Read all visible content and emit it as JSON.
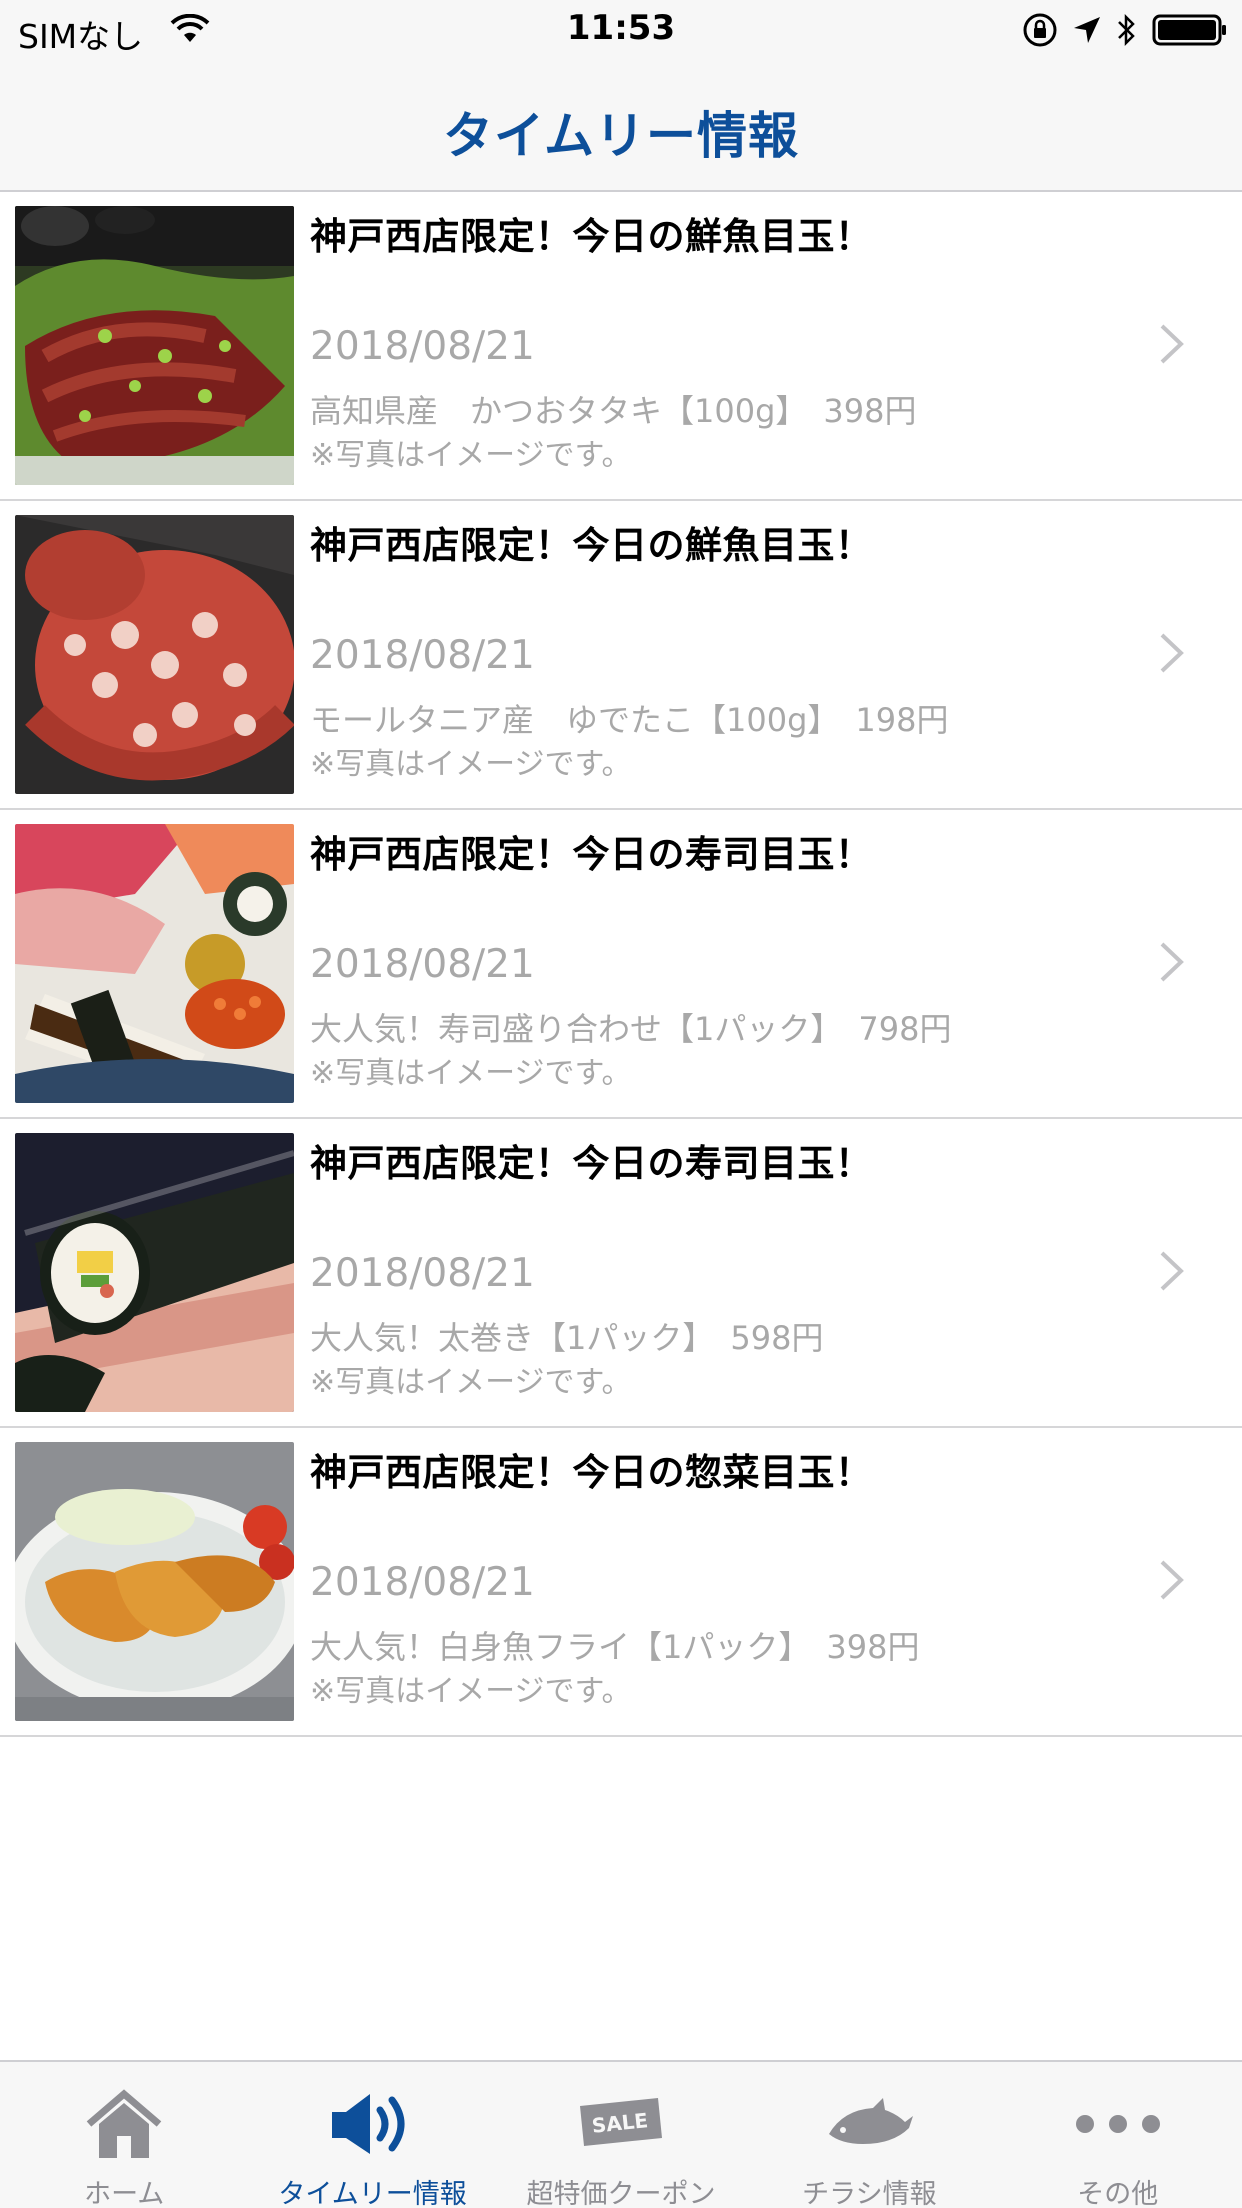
{
  "status_bar": {
    "carrier": "SIMなし",
    "time": "11:53"
  },
  "nav": {
    "title": "タイムリー情報"
  },
  "items": [
    {
      "title": "神戸西店限定！今日の鮮魚目玉！",
      "date": "2018/08/21",
      "description": "高知県産　かつおタタキ【100g】　398円",
      "note": "※写真はイメージです。",
      "image_icon": "katsuo-tataki-photo"
    },
    {
      "title": "神戸西店限定！今日の鮮魚目玉！",
      "date": "2018/08/21",
      "description": "モールタニア産　ゆでたこ【100g】　198円",
      "note": "※写真はイメージです。",
      "image_icon": "boiled-octopus-photo"
    },
    {
      "title": "神戸西店限定！今日の寿司目玉！",
      "date": "2018/08/21",
      "description": "大人気！寿司盛り合わせ【1パック】　798円",
      "note": "※写真はイメージです。",
      "image_icon": "sushi-platter-photo"
    },
    {
      "title": "神戸西店限定！今日の寿司目玉！",
      "date": "2018/08/21",
      "description": "大人気！太巻き【1パック】　598円",
      "note": "※写真はイメージです。",
      "image_icon": "futomaki-photo"
    },
    {
      "title": "神戸西店限定！今日の惣菜目玉！",
      "date": "2018/08/21",
      "description": "大人気！白身魚フライ【1パック】　398円",
      "note": "※写真はイメージです。",
      "image_icon": "fish-fry-photo"
    }
  ],
  "tabs": [
    {
      "label": "ホーム",
      "icon": "home-icon",
      "active": false
    },
    {
      "label": "タイムリー情報",
      "icon": "speaker-icon",
      "active": true
    },
    {
      "label": "超特価クーポン",
      "icon": "sale-tag-icon",
      "active": false
    },
    {
      "label": "チラシ情報",
      "icon": "fish-icon",
      "active": false
    },
    {
      "label": "その他",
      "icon": "more-icon",
      "active": false
    }
  ],
  "colors": {
    "accent": "#0d4f9a",
    "inactive_tab": "#8e8e93",
    "secondary_text": "#a8a8a8",
    "bar_background": "#f7f7f7"
  }
}
